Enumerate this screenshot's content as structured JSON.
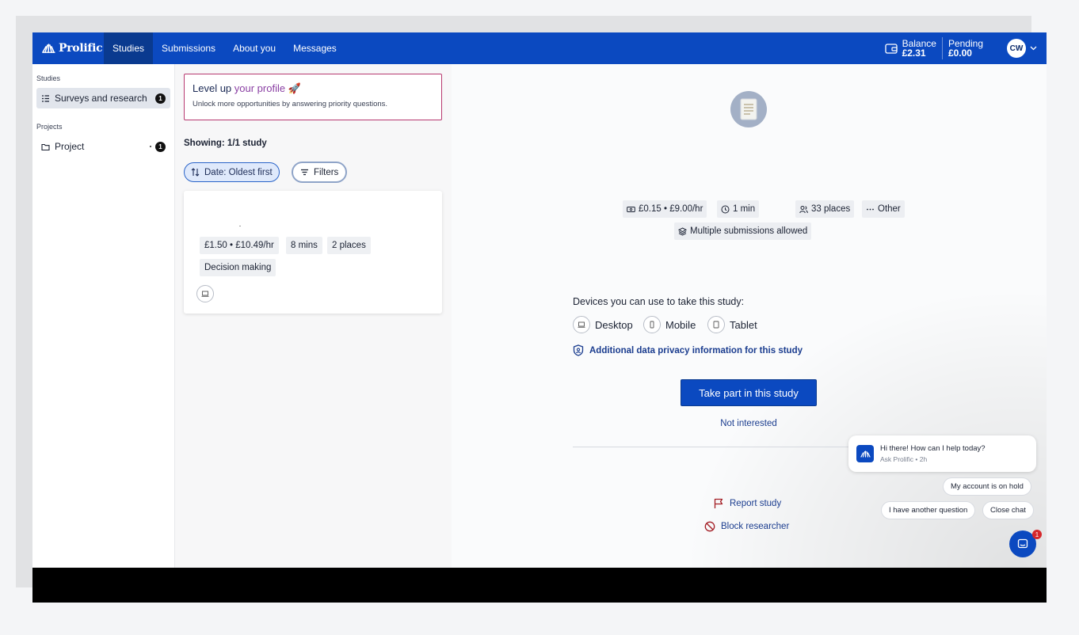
{
  "nav": {
    "logo": "Prolific",
    "tabs": [
      "Studies",
      "Submissions",
      "About you",
      "Messages"
    ],
    "balance_label": "Balance",
    "balance_value": "£2.31",
    "pending_label": "Pending",
    "pending_value": "£0.00",
    "avatar_initials": "CW"
  },
  "sidebar": {
    "studies_heading": "Studies",
    "studies_item": "Surveys and research",
    "studies_count": "1",
    "projects_heading": "Projects",
    "project_item": "Project",
    "project_count": "1"
  },
  "levelup": {
    "title_plain": "Level up ",
    "title_accent": "your profile",
    "title_emoji": "🚀",
    "subtitle": "Unlock more opportunities by answering priority questions."
  },
  "list": {
    "showing": "Showing: 1/1 study",
    "sort_label": "Date: Oldest first",
    "filters_label": "Filters"
  },
  "card": {
    "reward": "£1.50 • £10.49/hr",
    "time": "8 mins",
    "places": "2 places",
    "tag": "Decision making"
  },
  "detail": {
    "reward": "£0.15 • £9.00/hr",
    "time": "1 min",
    "places": "33 places",
    "category": "Other",
    "multiple": "Multiple submissions allowed",
    "devices_title": "Devices you can use to take this study:",
    "devices": [
      "Desktop",
      "Mobile",
      "Tablet"
    ],
    "privacy_link": "Additional data privacy information for this study",
    "take_part": "Take part in this study",
    "not_interested": "Not interested",
    "report": "Report study",
    "block": "Block researcher"
  },
  "chat": {
    "message": "Hi there! How can I help today?",
    "meta": "Ask Prolific • 2h",
    "chip_hold": "My account is on hold",
    "chip_other": "I have another question",
    "chip_close": "Close chat",
    "badge": "1"
  }
}
